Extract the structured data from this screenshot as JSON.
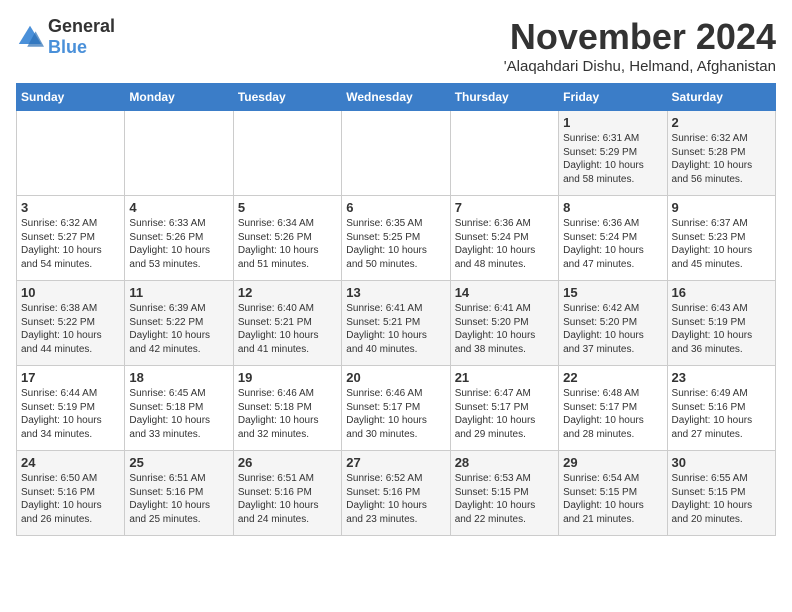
{
  "logo": {
    "general": "General",
    "blue": "Blue"
  },
  "header": {
    "month": "November 2024",
    "location": "'Alaqahdari Dishu, Helmand, Afghanistan"
  },
  "weekdays": [
    "Sunday",
    "Monday",
    "Tuesday",
    "Wednesday",
    "Thursday",
    "Friday",
    "Saturday"
  ],
  "weeks": [
    [
      {
        "day": "",
        "info": ""
      },
      {
        "day": "",
        "info": ""
      },
      {
        "day": "",
        "info": ""
      },
      {
        "day": "",
        "info": ""
      },
      {
        "day": "",
        "info": ""
      },
      {
        "day": "1",
        "info": "Sunrise: 6:31 AM\nSunset: 5:29 PM\nDaylight: 10 hours\nand 58 minutes."
      },
      {
        "day": "2",
        "info": "Sunrise: 6:32 AM\nSunset: 5:28 PM\nDaylight: 10 hours\nand 56 minutes."
      }
    ],
    [
      {
        "day": "3",
        "info": "Sunrise: 6:32 AM\nSunset: 5:27 PM\nDaylight: 10 hours\nand 54 minutes."
      },
      {
        "day": "4",
        "info": "Sunrise: 6:33 AM\nSunset: 5:26 PM\nDaylight: 10 hours\nand 53 minutes."
      },
      {
        "day": "5",
        "info": "Sunrise: 6:34 AM\nSunset: 5:26 PM\nDaylight: 10 hours\nand 51 minutes."
      },
      {
        "day": "6",
        "info": "Sunrise: 6:35 AM\nSunset: 5:25 PM\nDaylight: 10 hours\nand 50 minutes."
      },
      {
        "day": "7",
        "info": "Sunrise: 6:36 AM\nSunset: 5:24 PM\nDaylight: 10 hours\nand 48 minutes."
      },
      {
        "day": "8",
        "info": "Sunrise: 6:36 AM\nSunset: 5:24 PM\nDaylight: 10 hours\nand 47 minutes."
      },
      {
        "day": "9",
        "info": "Sunrise: 6:37 AM\nSunset: 5:23 PM\nDaylight: 10 hours\nand 45 minutes."
      }
    ],
    [
      {
        "day": "10",
        "info": "Sunrise: 6:38 AM\nSunset: 5:22 PM\nDaylight: 10 hours\nand 44 minutes."
      },
      {
        "day": "11",
        "info": "Sunrise: 6:39 AM\nSunset: 5:22 PM\nDaylight: 10 hours\nand 42 minutes."
      },
      {
        "day": "12",
        "info": "Sunrise: 6:40 AM\nSunset: 5:21 PM\nDaylight: 10 hours\nand 41 minutes."
      },
      {
        "day": "13",
        "info": "Sunrise: 6:41 AM\nSunset: 5:21 PM\nDaylight: 10 hours\nand 40 minutes."
      },
      {
        "day": "14",
        "info": "Sunrise: 6:41 AM\nSunset: 5:20 PM\nDaylight: 10 hours\nand 38 minutes."
      },
      {
        "day": "15",
        "info": "Sunrise: 6:42 AM\nSunset: 5:20 PM\nDaylight: 10 hours\nand 37 minutes."
      },
      {
        "day": "16",
        "info": "Sunrise: 6:43 AM\nSunset: 5:19 PM\nDaylight: 10 hours\nand 36 minutes."
      }
    ],
    [
      {
        "day": "17",
        "info": "Sunrise: 6:44 AM\nSunset: 5:19 PM\nDaylight: 10 hours\nand 34 minutes."
      },
      {
        "day": "18",
        "info": "Sunrise: 6:45 AM\nSunset: 5:18 PM\nDaylight: 10 hours\nand 33 minutes."
      },
      {
        "day": "19",
        "info": "Sunrise: 6:46 AM\nSunset: 5:18 PM\nDaylight: 10 hours\nand 32 minutes."
      },
      {
        "day": "20",
        "info": "Sunrise: 6:46 AM\nSunset: 5:17 PM\nDaylight: 10 hours\nand 30 minutes."
      },
      {
        "day": "21",
        "info": "Sunrise: 6:47 AM\nSunset: 5:17 PM\nDaylight: 10 hours\nand 29 minutes."
      },
      {
        "day": "22",
        "info": "Sunrise: 6:48 AM\nSunset: 5:17 PM\nDaylight: 10 hours\nand 28 minutes."
      },
      {
        "day": "23",
        "info": "Sunrise: 6:49 AM\nSunset: 5:16 PM\nDaylight: 10 hours\nand 27 minutes."
      }
    ],
    [
      {
        "day": "24",
        "info": "Sunrise: 6:50 AM\nSunset: 5:16 PM\nDaylight: 10 hours\nand 26 minutes."
      },
      {
        "day": "25",
        "info": "Sunrise: 6:51 AM\nSunset: 5:16 PM\nDaylight: 10 hours\nand 25 minutes."
      },
      {
        "day": "26",
        "info": "Sunrise: 6:51 AM\nSunset: 5:16 PM\nDaylight: 10 hours\nand 24 minutes."
      },
      {
        "day": "27",
        "info": "Sunrise: 6:52 AM\nSunset: 5:16 PM\nDaylight: 10 hours\nand 23 minutes."
      },
      {
        "day": "28",
        "info": "Sunrise: 6:53 AM\nSunset: 5:15 PM\nDaylight: 10 hours\nand 22 minutes."
      },
      {
        "day": "29",
        "info": "Sunrise: 6:54 AM\nSunset: 5:15 PM\nDaylight: 10 hours\nand 21 minutes."
      },
      {
        "day": "30",
        "info": "Sunrise: 6:55 AM\nSunset: 5:15 PM\nDaylight: 10 hours\nand 20 minutes."
      }
    ]
  ]
}
